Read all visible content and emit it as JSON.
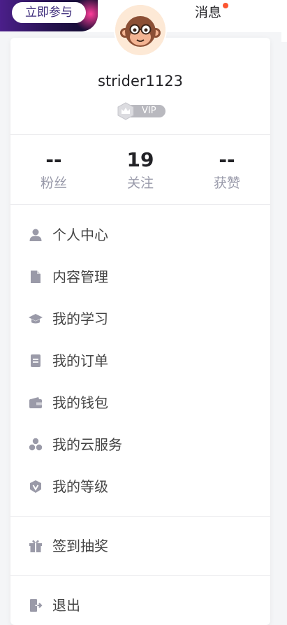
{
  "topbar": {
    "promo_button": "立即参与",
    "messages": "消息"
  },
  "profile": {
    "username": "strider1123",
    "vip_label": "VIP"
  },
  "stats": [
    {
      "value": "--",
      "label": "粉丝"
    },
    {
      "value": "19",
      "label": "关注"
    },
    {
      "value": "--",
      "label": "获赞"
    }
  ],
  "menu": {
    "main": [
      {
        "label": "个人中心",
        "icon": "user-icon"
      },
      {
        "label": "内容管理",
        "icon": "document-icon"
      },
      {
        "label": "我的学习",
        "icon": "graduation-cap-icon"
      },
      {
        "label": "我的订单",
        "icon": "order-icon"
      },
      {
        "label": "我的钱包",
        "icon": "wallet-icon"
      },
      {
        "label": "我的云服务",
        "icon": "cloud-service-icon"
      },
      {
        "label": "我的等级",
        "icon": "level-shield-icon"
      }
    ],
    "checkin": {
      "label": "签到抽奖",
      "icon": "gift-icon"
    },
    "logout": {
      "label": "退出",
      "icon": "logout-icon"
    }
  },
  "colors": {
    "notification_dot": "#fc5531",
    "icon_gray": "#9a9aa8",
    "vip_gray": "#b9b9bf"
  }
}
